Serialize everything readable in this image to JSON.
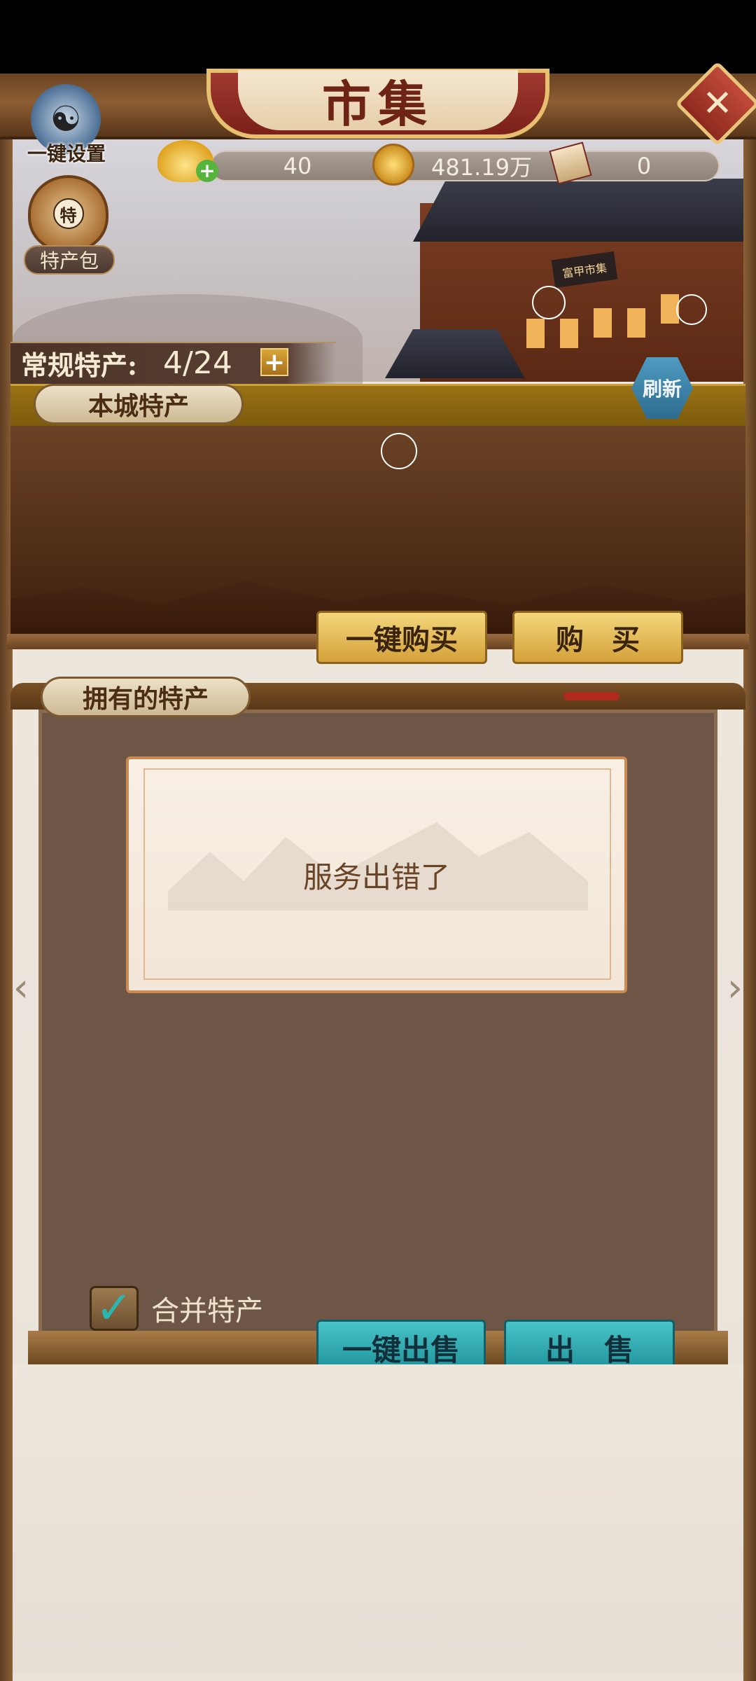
{
  "title": "市集",
  "settings": {
    "label": "一键设置"
  },
  "bag": {
    "tag": "特",
    "label": "特产包"
  },
  "resources": {
    "ingot": "40",
    "coins": "481.19万",
    "token": "0"
  },
  "scene": {
    "sign": "富甲市集"
  },
  "regular": {
    "label": "常规特产:",
    "count": "4/24",
    "plus": "+"
  },
  "refresh_label": "刷新",
  "local": {
    "tab": "本城特产",
    "buy_all": "一键购买",
    "buy": "购　买"
  },
  "owned": {
    "tab": "拥有的特产",
    "error": "服务出错了",
    "merge_label": "合并特产",
    "merge_checked": true,
    "sell_all": "一键出售",
    "sell": "出　售"
  },
  "icons": {
    "close": "close-icon",
    "settings": "taiji-settings-icon",
    "bag": "specialty-bag-icon",
    "ingot": "gold-ingot-icon",
    "coin": "copper-coin-icon",
    "token": "token-icon",
    "left": "chevron-left-icon",
    "right": "chevron-right-icon"
  },
  "close_symbol": "✕",
  "check_symbol": "✓",
  "arrow_left": "‹",
  "arrow_right": "›"
}
